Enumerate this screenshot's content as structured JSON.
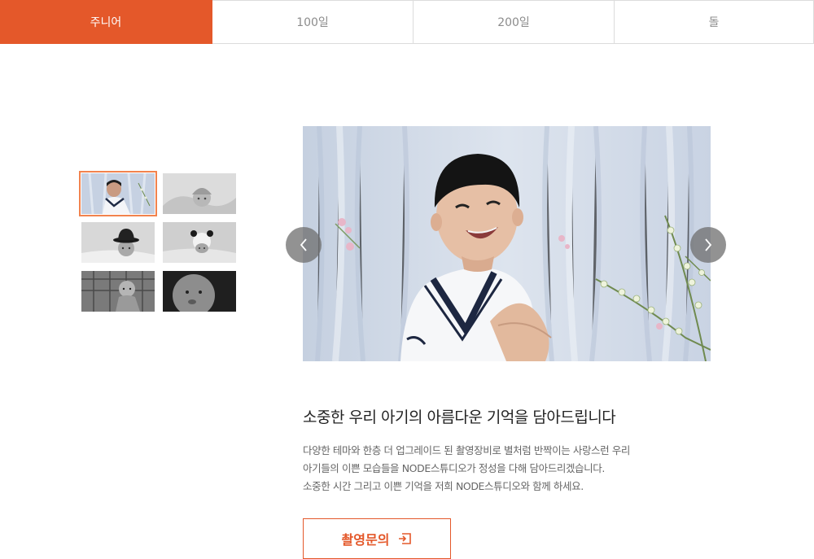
{
  "tabs": [
    {
      "label": "주니어",
      "active": true
    },
    {
      "label": "100일",
      "active": false
    },
    {
      "label": "200일",
      "active": false
    },
    {
      "label": "돌",
      "active": false
    }
  ],
  "gallery": {
    "thumbnails": [
      "junior-sailor-color",
      "baby-knit-hat-bw",
      "baby-black-hat-bw",
      "baby-panda-hat-bw",
      "baby-fence-bw",
      "baby-closeup-bw"
    ],
    "selected_index": 0,
    "prev_icon": "chevron-left-icon",
    "next_icon": "chevron-right-icon"
  },
  "content": {
    "headline": "소중한 우리 아기의 아름다운 기억을 담아드립니다",
    "description": [
      "다양한 테마와 한층 더 업그레이드 된 촬영장비로 별처럼 반짝이는 사랑스런 우리",
      "아기들의 이쁜 모습들을 NODE스튜디오가 정성을 다해 담아드리겠습니다.",
      "소중한 시간 그리고 이쁜 기억을 저희 NODE스튜디오와 함께 하세요."
    ],
    "cta_label": "촬영문의",
    "cta_icon": "enter-icon"
  },
  "colors": {
    "accent": "#e4582a",
    "thumb_border": "#f2834e"
  }
}
